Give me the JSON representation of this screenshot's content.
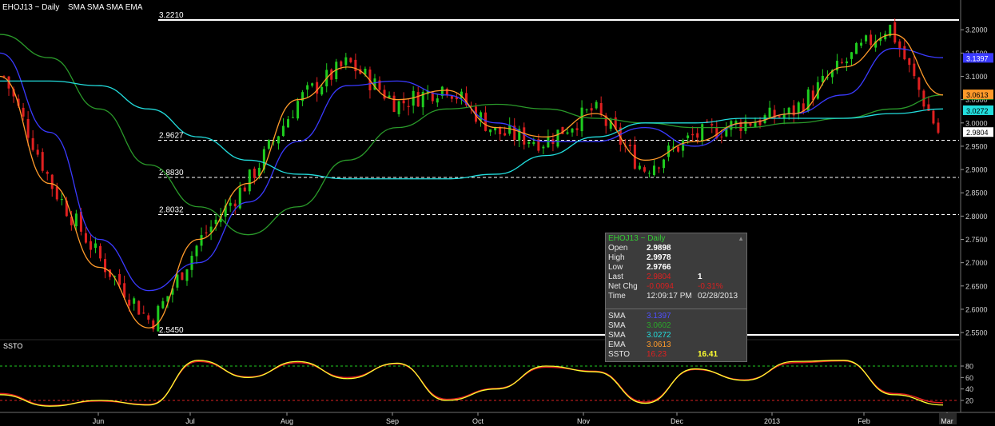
{
  "header": {
    "title": "EHOJ13 ~ Daily",
    "studies": "SMA SMA SMA EMA"
  },
  "colors": {
    "up": "#1fcc1f",
    "down": "#e02020",
    "sma1": "#3a3aff",
    "sma2": "#2a9a2a",
    "sma3": "#22dddd",
    "ema": "#ff9a2a",
    "ssto_k": "#ffff30",
    "ssto_d": "#e02020"
  },
  "chart_data": {
    "type": "candlestick",
    "symbol": "EHOJ13",
    "interval": "Daily",
    "y_axis": {
      "ylim": [
        2.51,
        3.235
      ],
      "ticks": [
        "3.2000",
        "3.1500",
        "3.1000",
        "3.0500",
        "3.0000",
        "2.9500",
        "2.9000",
        "2.8500",
        "2.8000",
        "2.7500",
        "2.7000",
        "2.6500",
        "2.6000",
        "2.5500"
      ]
    },
    "x_axis": {
      "ticks": [
        "Jun",
        "Jul",
        "Aug",
        "Sep",
        "Oct",
        "Nov",
        "Dec",
        "2013",
        "Feb",
        "Mar"
      ]
    },
    "levels": [
      {
        "label": "3.2210",
        "value": 3.221,
        "style": "solid"
      },
      {
        "label": "2.9627",
        "value": 2.9627,
        "style": "dashed"
      },
      {
        "label": "2.8830",
        "value": 2.883,
        "style": "dashed"
      },
      {
        "label": "2.8032",
        "value": 2.8032,
        "style": "dashed"
      },
      {
        "label": "2.5450",
        "value": 2.545,
        "style": "solid"
      }
    ],
    "close_path": [
      [
        "May",
        3.1
      ],
      [
        "Jun",
        2.86
      ],
      [
        "Jun",
        2.7
      ],
      [
        "Jul",
        2.57
      ],
      [
        "Jul",
        2.75
      ],
      [
        "Aug",
        2.88
      ],
      [
        "Aug",
        3.05
      ],
      [
        "Sep",
        3.13
      ],
      [
        "Sep",
        3.04
      ],
      [
        "Oct",
        3.08
      ],
      [
        "Oct",
        2.98
      ],
      [
        "Nov",
        2.96
      ],
      [
        "Nov",
        3.03
      ],
      [
        "Dec",
        2.9
      ],
      [
        "Dec",
        2.97
      ],
      [
        "2013",
        3.0
      ],
      [
        "2013",
        3.02
      ],
      [
        "Feb",
        3.12
      ],
      [
        "Feb",
        3.21
      ],
      [
        "Mar",
        2.98
      ]
    ],
    "series": [
      {
        "name": "SMA",
        "last": "3.1397",
        "path": [
          3.15,
          2.98,
          2.75,
          2.64,
          2.7,
          2.83,
          2.96,
          3.08,
          3.09,
          3.06,
          3.0,
          2.96,
          2.96,
          2.99,
          2.95,
          3.0,
          3.02,
          3.06,
          3.16,
          3.14
        ]
      },
      {
        "name": "SMA",
        "last": "3.0602",
        "path": [
          3.19,
          3.14,
          3.03,
          2.91,
          2.82,
          2.76,
          2.82,
          2.92,
          2.99,
          3.03,
          3.04,
          3.03,
          3.01,
          3.0,
          2.99,
          2.99,
          3.0,
          3.01,
          3.03,
          3.06
        ]
      },
      {
        "name": "SMA",
        "last": "3.0272",
        "path": [
          3.09,
          3.09,
          3.08,
          3.03,
          2.97,
          2.92,
          2.89,
          2.88,
          2.88,
          2.88,
          2.89,
          2.93,
          2.97,
          3.0,
          3.0,
          3.01,
          3.01,
          3.01,
          3.02,
          3.03
        ]
      },
      {
        "name": "EMA",
        "last": "3.0613",
        "path": [
          3.1,
          2.87,
          2.69,
          2.56,
          2.75,
          2.87,
          3.05,
          3.12,
          3.05,
          3.07,
          2.99,
          2.97,
          3.02,
          2.92,
          2.96,
          3.0,
          3.02,
          3.12,
          3.19,
          3.06
        ]
      }
    ],
    "last_price": "2.9804",
    "ssto": {
      "name": "SSTO",
      "ylim": [
        0,
        100
      ],
      "ticks": [
        "80",
        "60",
        "40",
        "20"
      ],
      "levels": [
        80,
        20
      ],
      "k_path": [
        30,
        10,
        20,
        12,
        90,
        60,
        88,
        58,
        85,
        20,
        40,
        80,
        70,
        15,
        75,
        55,
        88,
        90,
        30,
        12
      ],
      "d_path": [
        32,
        11,
        19,
        13,
        88,
        61,
        86,
        60,
        84,
        22,
        41,
        78,
        71,
        17,
        74,
        56,
        86,
        89,
        32,
        16
      ]
    }
  },
  "tooltip": {
    "title": "EHOJ13 ~ Daily",
    "rows": [
      {
        "k": "Open",
        "v": "2.9898"
      },
      {
        "k": "High",
        "v": "2.9978"
      },
      {
        "k": "Low",
        "v": "2.9766"
      },
      {
        "k": "Last",
        "v": "2.9804",
        "v2": "1"
      },
      {
        "k": "Net Chg",
        "v": "-0.0094",
        "v2": "-0.31%"
      },
      {
        "k": "Time",
        "v": "12:09:17 PM",
        "v2": "02/28/2013"
      }
    ],
    "studies": [
      {
        "k": "SMA",
        "v": "3.1397"
      },
      {
        "k": "SMA",
        "v": "3.0602"
      },
      {
        "k": "SMA",
        "v": "3.0272"
      },
      {
        "k": "EMA",
        "v": "3.0613"
      },
      {
        "k": "SSTO",
        "v": "16.23",
        "v2": "16.41"
      }
    ]
  }
}
